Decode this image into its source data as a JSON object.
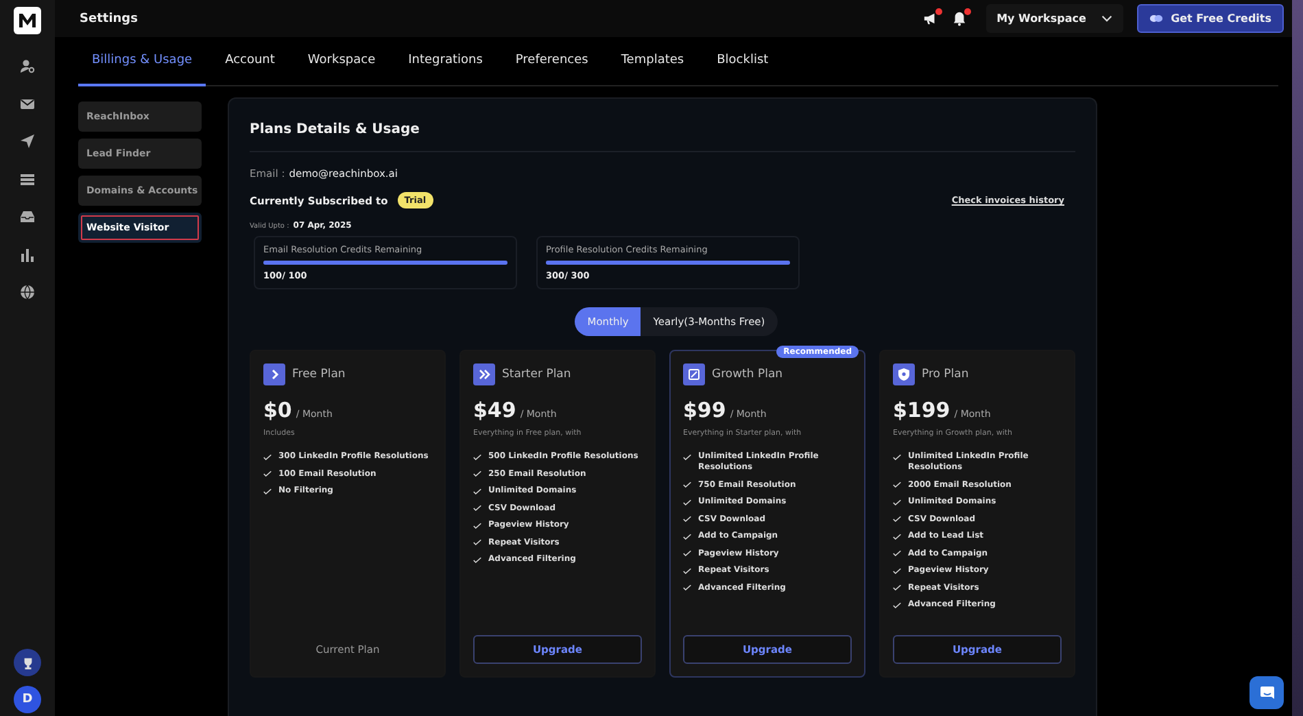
{
  "header": {
    "title": "Settings",
    "workspace": "My Workspace",
    "credits_button": "Get Free Credits"
  },
  "avatar": {
    "initial": "D"
  },
  "tabs": [
    {
      "label": "Billings & Usage",
      "selected": true
    },
    {
      "label": "Account",
      "selected": false
    },
    {
      "label": "Workspace",
      "selected": false
    },
    {
      "label": "Integrations",
      "selected": false
    },
    {
      "label": "Preferences",
      "selected": false
    },
    {
      "label": "Templates",
      "selected": false
    },
    {
      "label": "Blocklist",
      "selected": false
    }
  ],
  "side_menu": [
    {
      "label": "ReachInbox",
      "selected": false
    },
    {
      "label": "Lead Finder",
      "selected": false
    },
    {
      "label": "Domains & Accounts",
      "selected": false
    },
    {
      "label": "Website Visitor",
      "selected": true
    }
  ],
  "panel": {
    "title": "Plans Details & Usage",
    "email_label": "Email :",
    "email": "demo@reachinbox.ai",
    "subscribed_label": "Currently Subscribed to",
    "plan_badge": "Trial",
    "invoices_link": "Check invoices history",
    "valid_label": "Valid Upto :",
    "valid_date": "07 Apr, 2025"
  },
  "credits": [
    {
      "label": "Email Resolution Credits Remaining",
      "level": 1,
      "reading": "100/ 100"
    },
    {
      "label": "Profile Resolution Credits Remaining",
      "level": 1,
      "reading": "300/ 300"
    }
  ],
  "billing_toggle": [
    {
      "label": "Monthly",
      "selected": true
    },
    {
      "label": "Yearly(3-Months Free)",
      "selected": false
    }
  ],
  "plans": [
    {
      "name": "Free Plan",
      "price": "$0",
      "period": "/ Month",
      "includes": "Includes",
      "features": [
        "300 LinkedIn Profile Resolutions",
        "100 Email Resolution",
        "No Filtering"
      ],
      "action": {
        "kind": "label",
        "text": "Current Plan"
      }
    },
    {
      "name": "Starter Plan",
      "price": "$49",
      "period": "/ Month",
      "includes": "Everything in Free plan, with",
      "features": [
        "500 LinkedIn Profile Resolutions",
        "250 Email Resolution",
        "Unlimited Domains",
        "CSV Download",
        "Pageview History",
        "Repeat Visitors",
        "Advanced Filtering"
      ],
      "action": {
        "kind": "button",
        "text": "Upgrade"
      }
    },
    {
      "name": "Growth Plan",
      "price": "$99",
      "period": "/ Month",
      "includes": "Everything in Starter plan, with",
      "features": [
        "Unlimited LinkedIn Profile Resolutions",
        "750 Email Resolution",
        "Unlimited Domains",
        "CSV Download",
        "Add to Campaign",
        "Pageview History",
        "Repeat Visitors",
        "Advanced Filtering"
      ],
      "action": {
        "kind": "button",
        "text": "Upgrade"
      },
      "badge": "Recommended"
    },
    {
      "name": "Pro Plan",
      "price": "$199",
      "period": "/ Month",
      "includes": "Everything in Growth plan, with",
      "features": [
        "Unlimited LinkedIn Profile Resolutions",
        "2000 Email Resolution",
        "Unlimited Domains",
        "CSV Download",
        "Add to Lead List",
        "Add to Campaign",
        "Pageview History",
        "Repeat Visitors",
        "Advanced Filtering"
      ],
      "action": {
        "kind": "button",
        "text": "Upgrade"
      }
    }
  ]
}
